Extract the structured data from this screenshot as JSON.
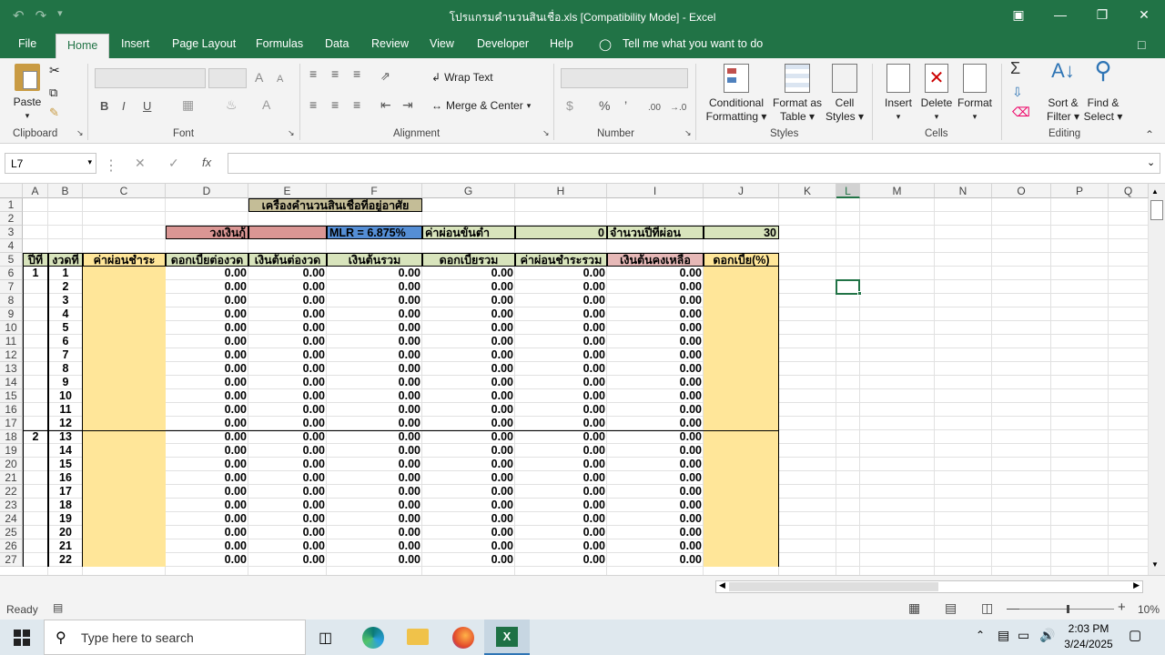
{
  "window": {
    "title": "โปรแกรมคำนวนสินเชื่อ.xls  [Compatibility Mode]  -  Excel",
    "undo_icon": "undo-icon",
    "redo_icon": "redo-icon"
  },
  "tabs": [
    "File",
    "Home",
    "Insert",
    "Page Layout",
    "Formulas",
    "Data",
    "Review",
    "View",
    "Developer",
    "Help"
  ],
  "tell_me": "Tell me what you want to do",
  "ribbon": {
    "clipboard": {
      "paste": "Paste",
      "label": "Clipboard"
    },
    "font": {
      "label": "Font",
      "bold": "B",
      "italic": "I",
      "underline": "U",
      "grow": "A",
      "shrink": "A",
      "color": "A"
    },
    "alignment": {
      "label": "Alignment",
      "wrap": "Wrap Text",
      "merge": "Merge & Center"
    },
    "number": {
      "label": "Number",
      "currency": "$",
      "percent": "%",
      "comma": "’",
      "inc": ".00",
      "dec": "→.0"
    },
    "styles": {
      "label": "Styles",
      "conditional": "Conditional",
      "conditional2": "Formatting",
      "format_table": "Format as",
      "format_table2": "Table",
      "cell_styles": "Cell",
      "cell_styles2": "Styles"
    },
    "cells": {
      "label": "Cells",
      "insert": "Insert",
      "delete": "Delete",
      "format": "Format"
    },
    "editing": {
      "label": "Editing",
      "sort": "Sort &",
      "sort2": "Filter",
      "find": "Find &",
      "find2": "Select",
      "sum": "Σ"
    }
  },
  "formula_bar": {
    "name_box": "L7",
    "fx": "fx",
    "content": ""
  },
  "columns": [
    "A",
    "B",
    "C",
    "D",
    "E",
    "F",
    "G",
    "H",
    "I",
    "J",
    "K",
    "L",
    "M",
    "N",
    "O",
    "P",
    "Q"
  ],
  "rows": [
    "1",
    "2",
    "3",
    "4",
    "5",
    "6",
    "7",
    "8",
    "9",
    "10",
    "11",
    "12",
    "13",
    "14",
    "15",
    "16",
    "17",
    "18",
    "19",
    "20",
    "21",
    "22",
    "23",
    "24",
    "25",
    "26",
    "27"
  ],
  "sheet": {
    "title": "เครื่องคำนวนสินเชื่อที่อยู่อาศัย",
    "loan_label": "วงเงินกู้",
    "mlr": "MLR = 6.875%",
    "min_pay_label": "ค่าผ่อนขั้นต่ำ",
    "min_pay_value": "0",
    "years_label": "จำนวนปีที่ผ่อน",
    "years_value": "30",
    "headers": [
      "ปีที่",
      "งวดที่",
      "ค่าผ่อนชำระ",
      "ดอกเบี้ยต่องวด",
      "เงินต้นต่องวด",
      "เงินต้นรวม",
      "ดอกเบี้ยรวม",
      "ค่าผ่อนชำระรวม",
      "เงินต้นคงเหลือ",
      "ดอกเบี้ย(%)"
    ],
    "year_marks": [
      {
        "row": 0,
        "value": "1"
      },
      {
        "row": 12,
        "value": "2"
      }
    ],
    "periods": [
      "1",
      "2",
      "3",
      "4",
      "5",
      "6",
      "7",
      "8",
      "9",
      "10",
      "11",
      "12",
      "13",
      "14",
      "15",
      "16",
      "17",
      "18",
      "19",
      "20",
      "21",
      "22"
    ],
    "zero": "0.00"
  },
  "status": {
    "ready": "Ready",
    "zoom": "10%"
  },
  "taskbar": {
    "search_placeholder": "Type here to search",
    "time": "2:03 PM",
    "date": "3/24/2025"
  },
  "colors": {
    "excel_green": "#217346",
    "salmon": "#da9694",
    "blue": "#558ed5",
    "lightgreen": "#d8e4bc",
    "tan": "#c4bd97",
    "yellow": "#ffe699",
    "pink": "#e6b8b7"
  }
}
